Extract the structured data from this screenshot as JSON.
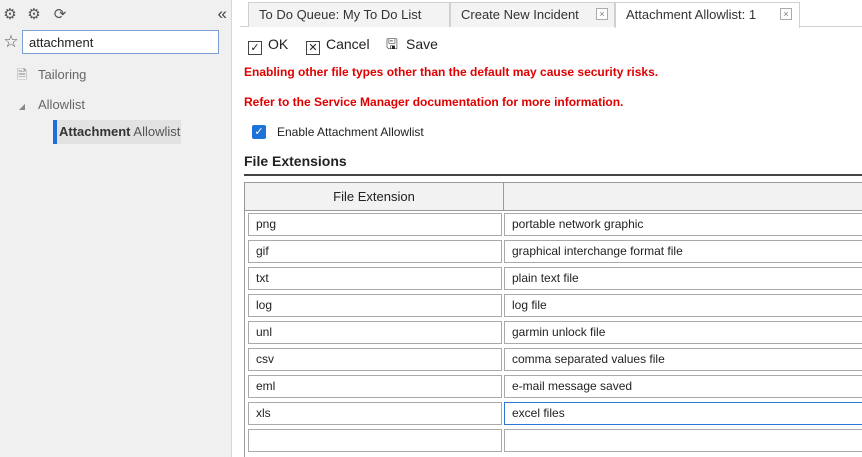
{
  "sidebar": {
    "search_value": "attachment",
    "tree": {
      "tailoring": "Tailoring",
      "allowlist": "Allowlist",
      "leaf_bold": "Attachment",
      "leaf_rest": " Allowlist"
    }
  },
  "tabs": [
    {
      "label": "To Do Queue: My To Do List"
    },
    {
      "label": "Create New Incident"
    },
    {
      "label": "Attachment Allowlist: 1"
    }
  ],
  "toolbar": {
    "ok_label": "OK",
    "cancel_label": "Cancel",
    "save_label": "Save"
  },
  "messages": {
    "warning_1": "Enabling other file types other than the default may cause security risks.",
    "warning_2": "Refer to the Service Manager documentation for more information."
  },
  "enable_checkbox": {
    "label": "Enable Attachment Allowlist",
    "checked": true
  },
  "file_extensions": {
    "title": "File Extensions",
    "column_header": "File Extension",
    "rows": [
      {
        "ext": "png",
        "desc": "portable network graphic"
      },
      {
        "ext": "gif",
        "desc": "graphical interchange format file"
      },
      {
        "ext": "txt",
        "desc": "plain text file"
      },
      {
        "ext": "log",
        "desc": "log file"
      },
      {
        "ext": "unl",
        "desc": "garmin unlock file"
      },
      {
        "ext": "csv",
        "desc": "comma separated values file"
      },
      {
        "ext": "eml",
        "desc": "e-mail message saved"
      },
      {
        "ext": "xls",
        "desc": "excel files"
      },
      {
        "ext": "",
        "desc": ""
      }
    ]
  },
  "colors": {
    "accent": "#1e73d9",
    "warning": "#e00000"
  }
}
